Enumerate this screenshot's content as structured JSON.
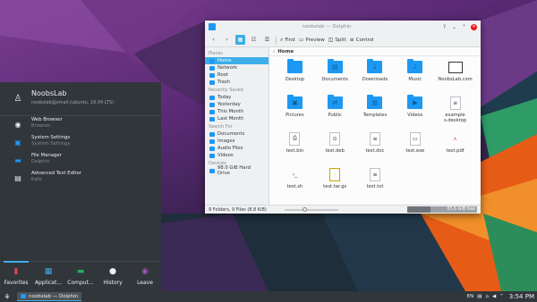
{
  "dolphin": {
    "window_title": "noobslab — Dolphin",
    "toolbar": {
      "find": "Find",
      "preview": "Preview",
      "split": "Split",
      "control": "Control"
    },
    "places": {
      "sections": [
        {
          "title": "Places",
          "items": [
            {
              "label": "Home",
              "icon": "home-icon",
              "selected": true
            },
            {
              "label": "Network",
              "icon": "network-icon",
              "selected": false
            },
            {
              "label": "Root",
              "icon": "root-icon",
              "selected": false
            },
            {
              "label": "Trash",
              "icon": "trash-icon",
              "selected": false
            }
          ]
        },
        {
          "title": "Recently Saved",
          "items": [
            {
              "label": "Today",
              "icon": "calendar-icon",
              "selected": false
            },
            {
              "label": "Yesterday",
              "icon": "calendar-icon",
              "selected": false
            },
            {
              "label": "This Month",
              "icon": "calendar-icon",
              "selected": false
            },
            {
              "label": "Last Month",
              "icon": "calendar-icon",
              "selected": false
            }
          ]
        },
        {
          "title": "Search For",
          "items": [
            {
              "label": "Documents",
              "icon": "document-icon",
              "selected": false
            },
            {
              "label": "Images",
              "icon": "image-icon",
              "selected": false
            },
            {
              "label": "Audio Files",
              "icon": "audio-icon",
              "selected": false
            },
            {
              "label": "Videos",
              "icon": "video-icon",
              "selected": false
            }
          ]
        },
        {
          "title": "Devices",
          "items": [
            {
              "label": "98.0 GiB Hard Drive",
              "icon": "drive-icon",
              "selected": false
            }
          ]
        }
      ]
    },
    "breadcrumb": "Home",
    "files": [
      {
        "name": "Desktop",
        "kind": "folder",
        "glyph": ""
      },
      {
        "name": "Documents",
        "kind": "folder",
        "glyph": "▤"
      },
      {
        "name": "Downloads",
        "kind": "folder",
        "glyph": "↓"
      },
      {
        "name": "Music",
        "kind": "folder",
        "glyph": "♪"
      },
      {
        "name": "NoobsLab.com",
        "kind": "doc",
        "glyph": ""
      },
      {
        "name": "Pictures",
        "kind": "folder",
        "glyph": "▣"
      },
      {
        "name": "Public",
        "kind": "folder",
        "glyph": "⇄"
      },
      {
        "name": "Templates",
        "kind": "folder",
        "glyph": "▥"
      },
      {
        "name": "Videos",
        "kind": "folder",
        "glyph": "▶"
      },
      {
        "name": "example s.desktop",
        "kind": "doc",
        "glyph": "≡"
      },
      {
        "name": "test.bin",
        "kind": "doc",
        "glyph": "⎙"
      },
      {
        "name": "test.deb",
        "kind": "doc",
        "glyph": "⊙"
      },
      {
        "name": "test.doc",
        "kind": "doc",
        "glyph": "≡"
      },
      {
        "name": "test.exe",
        "kind": "doc",
        "glyph": "▭"
      },
      {
        "name": "test.pdf",
        "kind": "doc",
        "glyph": "⋏"
      },
      {
        "name": "test.sh",
        "kind": "doc",
        "glyph": "›_"
      },
      {
        "name": "test.tar.gz",
        "kind": "doc",
        "glyph": "⋮"
      },
      {
        "name": "test.txt",
        "kind": "doc",
        "glyph": "≡"
      }
    ],
    "status": {
      "summary": "9 Folders, 9 Files (8.8 KiB)",
      "free_space": "65.6 GiB free",
      "used_fraction": 0.33
    }
  },
  "kickoff": {
    "user_name": "NoobsLab",
    "user_sub": "noobslab@xmail.(ubuntu, 16.04 LTS)",
    "favorites": [
      {
        "title": "Web Browser",
        "subtitle": "Browser",
        "icon": "globe-icon"
      },
      {
        "title": "System Settings",
        "subtitle": "System Settings",
        "icon": "settings-icon"
      },
      {
        "title": "File Manager",
        "subtitle": "Dolphin",
        "icon": "folder-icon"
      },
      {
        "title": "Advanced Text Editor",
        "subtitle": "Kate",
        "icon": "text-editor-icon"
      }
    ],
    "tabs": [
      {
        "label": "Favorites",
        "active": true
      },
      {
        "label": "Applicat...",
        "active": false
      },
      {
        "label": "Comput...",
        "active": false
      },
      {
        "label": "History",
        "active": false
      },
      {
        "label": "Leave",
        "active": false
      }
    ]
  },
  "panel": {
    "task_label": "noobslab — Dolphin",
    "keyboard_layout": "EN",
    "clock": "3:54 PM"
  },
  "colors": {
    "accent": "#3daee9",
    "folder_blue": "#1d99f3",
    "dark_panel": "#31363b",
    "window_bg": "#eff0f1"
  }
}
